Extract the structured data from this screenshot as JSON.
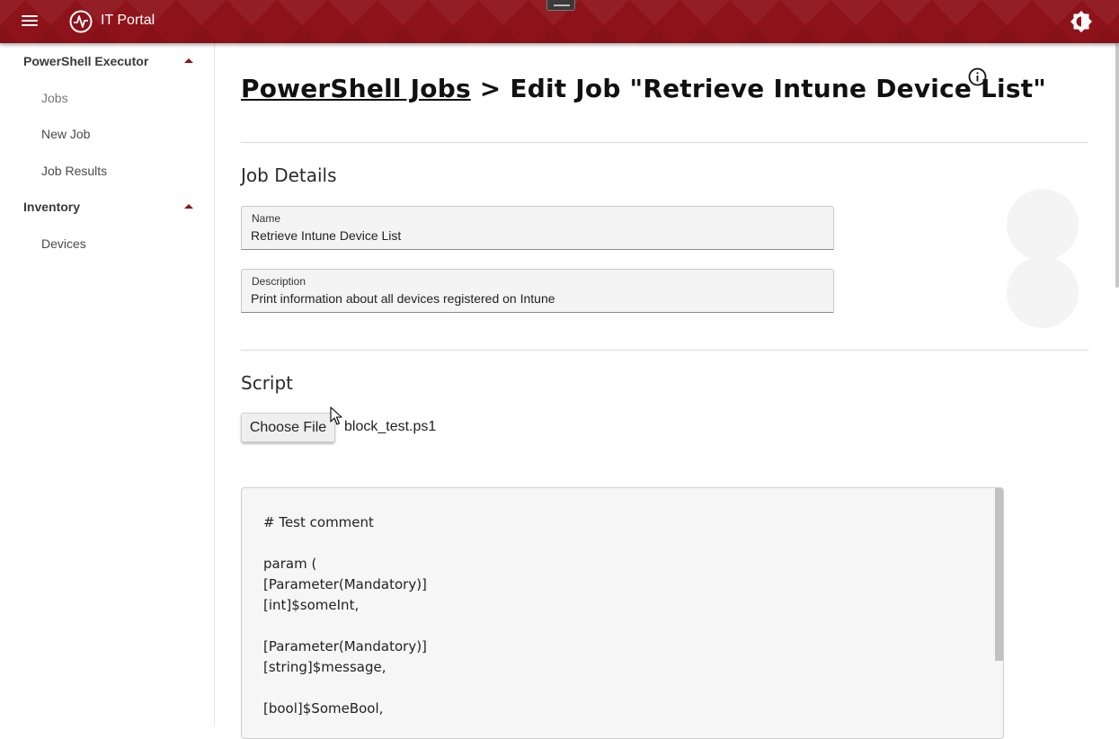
{
  "app": {
    "title": "IT Portal",
    "brand_color": "#8e1219",
    "menu_icon": "hamburger-icon",
    "logo_icon": "pulse-logo-icon",
    "theme_icon": "brightness-icon"
  },
  "sidebar": {
    "groups": [
      {
        "label": "PowerShell Executor",
        "items": [
          {
            "label": "Jobs"
          },
          {
            "label": "New Job"
          },
          {
            "label": "Job Results"
          }
        ]
      },
      {
        "label": "Inventory",
        "items": [
          {
            "label": "Devices"
          }
        ]
      }
    ]
  },
  "page": {
    "breadcrumb_link": "PowerShell Jobs",
    "breadcrumb_separator": " > ",
    "title": "Edit Job \"Retrieve Intune Device List\"",
    "info_icon": "info-icon"
  },
  "job_details": {
    "section_title": "Job Details",
    "name_label": "Name",
    "name_value": "Retrieve Intune Device List",
    "description_label": "Description",
    "description_value": "Print information about all devices registered on Intune"
  },
  "script": {
    "section_title": "Script",
    "choose_file_label": "Choose File",
    "file_name": "block_test.ps1",
    "code_lines": [
      "# Test comment",
      "",
      "param (",
      "[Parameter(Mandatory)]",
      "[int]$someInt,",
      "",
      "[Parameter(Mandatory)]",
      "[string]$message,",
      "",
      "[bool]$SomeBool,"
    ]
  }
}
